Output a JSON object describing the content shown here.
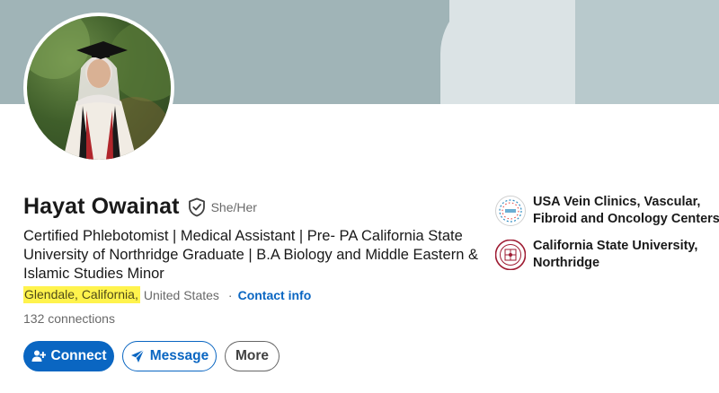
{
  "profile": {
    "name": "Hayat Owainat",
    "pronouns": "She/Her",
    "headline": "Certified Phlebotomist |  Medical Assistant  |  Pre- PA California State University of Northridge Graduate  | B.A Biology and Middle Eastern & Islamic Studies Minor",
    "location_highlighted": "Glendale, California,",
    "location_rest": "United States",
    "separator": "·",
    "contact_info": "Contact info",
    "connections": "132 connections"
  },
  "actions": {
    "connect": "Connect",
    "message": "Message",
    "more": "More"
  },
  "orgs": [
    {
      "name": "USA Vein Clinics, Vascular, Fibroid and Oncology Centers",
      "icon": "usa-vein-clinics-logo"
    },
    {
      "name": "California State University, Northridge",
      "icon": "csun-seal-logo"
    }
  ],
  "colors": {
    "accent": "#0a66c2",
    "highlight": "#fff34d",
    "cover": "#a0b4b7"
  }
}
